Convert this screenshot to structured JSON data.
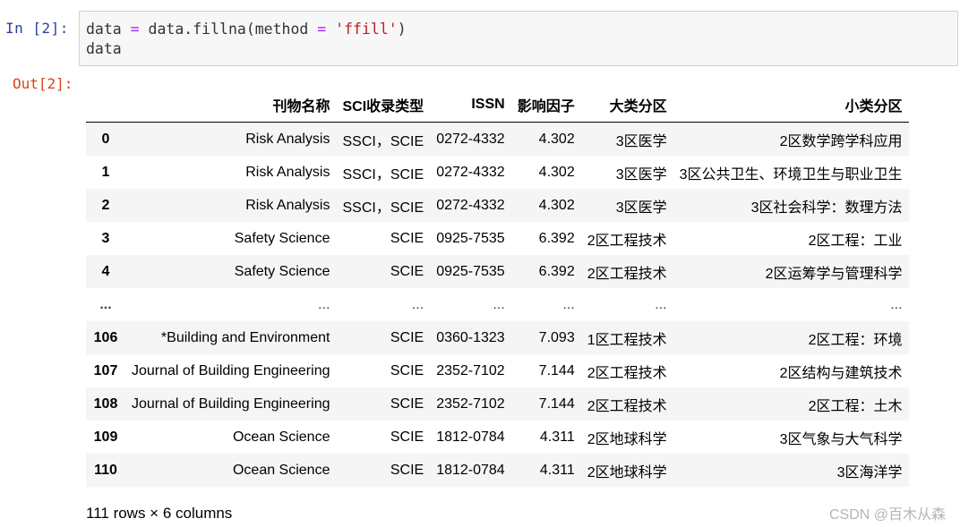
{
  "cell": {
    "in_prompt": "In  [2]:",
    "out_prompt": "Out[2]:",
    "code": {
      "l1_a": "data ",
      "l1_eq": "=",
      "l1_b": " data.fillna(method ",
      "l1_eq2": "=",
      "l1_sp": " ",
      "l1_str": "'ffill'",
      "l1_c": ")",
      "l2": "data"
    }
  },
  "table": {
    "columns": [
      "",
      "刊物名称",
      "SCI收录类型",
      "ISSN",
      "影响因子",
      "大类分区",
      "小类分区"
    ],
    "rows": [
      [
        "0",
        "Risk Analysis",
        "SSCI，SCIE",
        "0272-4332",
        "4.302",
        "3区医学",
        "2区数学跨学科应用"
      ],
      [
        "1",
        "Risk Analysis",
        "SSCI，SCIE",
        "0272-4332",
        "4.302",
        "3区医学",
        "3区公共卫生、环境卫生与职业卫生"
      ],
      [
        "2",
        "Risk Analysis",
        "SSCI，SCIE",
        "0272-4332",
        "4.302",
        "3区医学",
        "3区社会科学：数理方法"
      ],
      [
        "3",
        "Safety Science",
        "SCIE",
        "0925-7535",
        "6.392",
        "2区工程技术",
        "2区工程：工业"
      ],
      [
        "4",
        "Safety Science",
        "SCIE",
        "0925-7535",
        "6.392",
        "2区工程技术",
        "2区运筹学与管理科学"
      ],
      [
        "...",
        "...",
        "...",
        "...",
        "...",
        "...",
        "..."
      ],
      [
        "106",
        "*Building and Environment",
        "SCIE",
        "0360-1323",
        "7.093",
        "1区工程技术",
        "2区工程：环境"
      ],
      [
        "107",
        "Journal of Building Engineering",
        "SCIE",
        "2352-7102",
        "7.144",
        "2区工程技术",
        "2区结构与建筑技术"
      ],
      [
        "108",
        "Journal of Building Engineering",
        "SCIE",
        "2352-7102",
        "7.144",
        "2区工程技术",
        "2区工程：土木"
      ],
      [
        "109",
        "Ocean Science",
        "SCIE",
        "1812-0784",
        "4.311",
        "2区地球科学",
        "3区气象与大气科学"
      ],
      [
        "110",
        "Ocean Science",
        "SCIE",
        "1812-0784",
        "4.311",
        "2区地球科学",
        "3区海洋学"
      ]
    ],
    "summary": "111 rows × 6 columns"
  },
  "watermark": "CSDN @百木从森",
  "colors": {
    "in_prompt": "#303f9f",
    "out_prompt": "#d84315",
    "operator": "#aa22ff",
    "string": "#ba2121"
  }
}
